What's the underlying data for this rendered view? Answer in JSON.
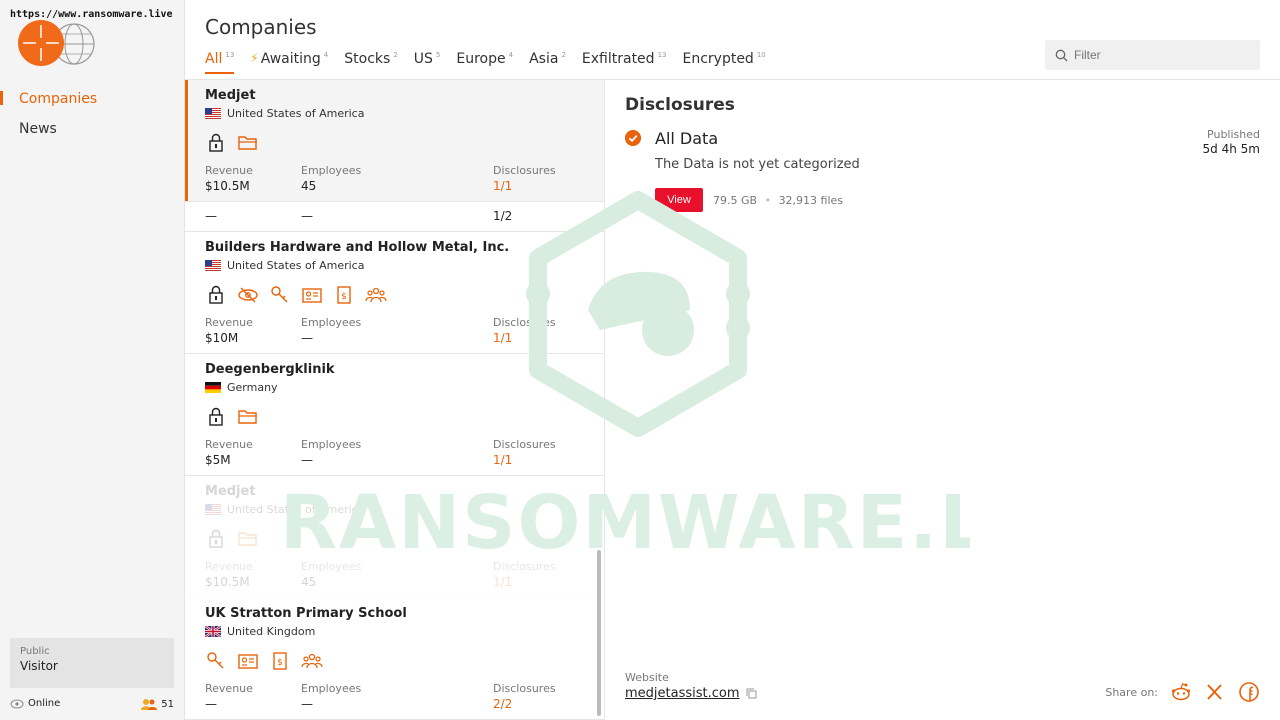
{
  "site_url": "https://www.ransomware.live",
  "sidebar": {
    "items": [
      {
        "label": "Companies",
        "active": true
      },
      {
        "label": "News",
        "active": false
      }
    ],
    "user": {
      "role": "Public",
      "name": "Visitor"
    },
    "status": {
      "online_label": "Online",
      "count": "51"
    }
  },
  "header": {
    "title": "Companies",
    "tabs": [
      {
        "label": "All",
        "count": "13",
        "active": true
      },
      {
        "label": "Awaiting",
        "count": "4",
        "active": false
      },
      {
        "label": "Stocks",
        "count": "2",
        "active": false
      },
      {
        "label": "US",
        "count": "5",
        "active": false
      },
      {
        "label": "Europe",
        "count": "4",
        "active": false
      },
      {
        "label": "Asia",
        "count": "2",
        "active": false
      },
      {
        "label": "Exfiltrated",
        "count": "13",
        "active": false
      },
      {
        "label": "Encrypted",
        "count": "10",
        "active": false
      }
    ],
    "filter_placeholder": "Filter"
  },
  "companies": [
    {
      "name": "Medjet",
      "country": "United States of America",
      "revenue": "$10.5M",
      "employees": "45",
      "disclosures": "1/1"
    },
    {
      "partial_employees": "—",
      "partial_revenue": "—",
      "partial_disclosures": "1/2"
    },
    {
      "name": "Builders Hardware and Hollow Metal, Inc.",
      "country": "United States of America",
      "revenue": "$10M",
      "employees": "—",
      "disclosures": "1/1"
    },
    {
      "name": "Deegenbergklinik",
      "country": "Germany",
      "revenue": "$5M",
      "employees": "—",
      "disclosures": "1/1"
    },
    {
      "name": "Medjet",
      "country": "United States of America",
      "revenue": "$10.5M",
      "employees": "45",
      "disclosures": "1/1"
    },
    {
      "name": "UK Stratton Primary School",
      "country": "United Kingdom",
      "revenue": "—",
      "employees": "—",
      "disclosures": "2/2"
    }
  ],
  "labels": {
    "revenue": "Revenue",
    "employees": "Employees",
    "disclosures": "Disclosures"
  },
  "detail": {
    "title": "Disclosures",
    "entry": {
      "title": "All Data",
      "description": "The Data is not yet categorized",
      "published_label": "Published",
      "published_value": "5d 4h 5m",
      "view_label": "View",
      "size": "79.5 GB",
      "files": "32,913 files"
    },
    "website_label": "Website",
    "website": "medjetassist.com",
    "share_label": "Share on:"
  },
  "colors": {
    "accent": "#e8630a",
    "view_button": "#e8102a"
  }
}
